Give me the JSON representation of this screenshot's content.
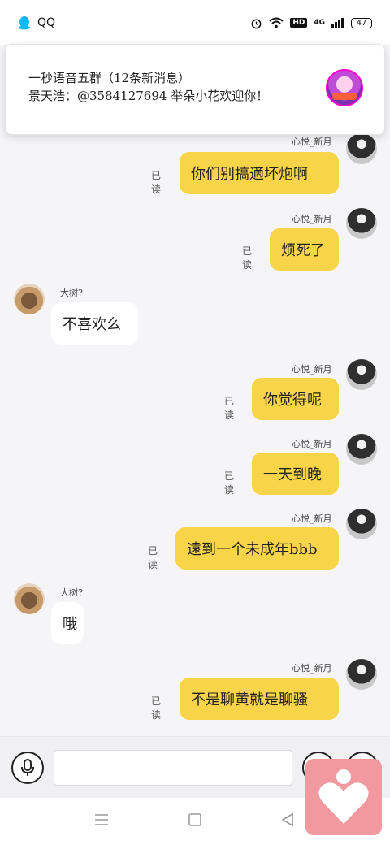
{
  "status_bar": {
    "app": "QQ",
    "hd": "HD",
    "network": "4G",
    "battery": "47"
  },
  "notification": {
    "title": "一秒语音五群（12条新消息）",
    "body": "景天浩：@3584127694 举朵小花欢迎你！"
  },
  "messages": [
    {
      "side": "out",
      "nick": "心悦_新月",
      "text": "你们别搞適坏炮啊",
      "read": "已读"
    },
    {
      "side": "out",
      "nick": "心悦_新月",
      "text": "烦死了",
      "read": "已读"
    },
    {
      "side": "in",
      "nick": "大树?",
      "text": "不喜欢么"
    },
    {
      "side": "out",
      "nick": "心悦_新月",
      "text": "你觉得呢",
      "read": "已读"
    },
    {
      "side": "out",
      "nick": "心悦_新月",
      "text": "一天到晚",
      "read": "已读"
    },
    {
      "side": "out",
      "nick": "心悦_新月",
      "text": "遠到一个未成年bbb",
      "read": "已读"
    },
    {
      "side": "in",
      "nick": "大树?",
      "text": "哦"
    },
    {
      "side": "out",
      "nick": "心悦_新月",
      "text": "不是聊黄就是聊骚",
      "read": "已读"
    }
  ],
  "input": {
    "placeholder": ""
  },
  "icons": {
    "mic": "microphone-icon",
    "emoji": "emoji-icon",
    "plus": "plus-icon",
    "heart": "heart-icon"
  },
  "colors": {
    "outgoing_bubble": "#f8d548",
    "incoming_bubble": "#ffffff",
    "floating_button": "#f09aa0"
  }
}
